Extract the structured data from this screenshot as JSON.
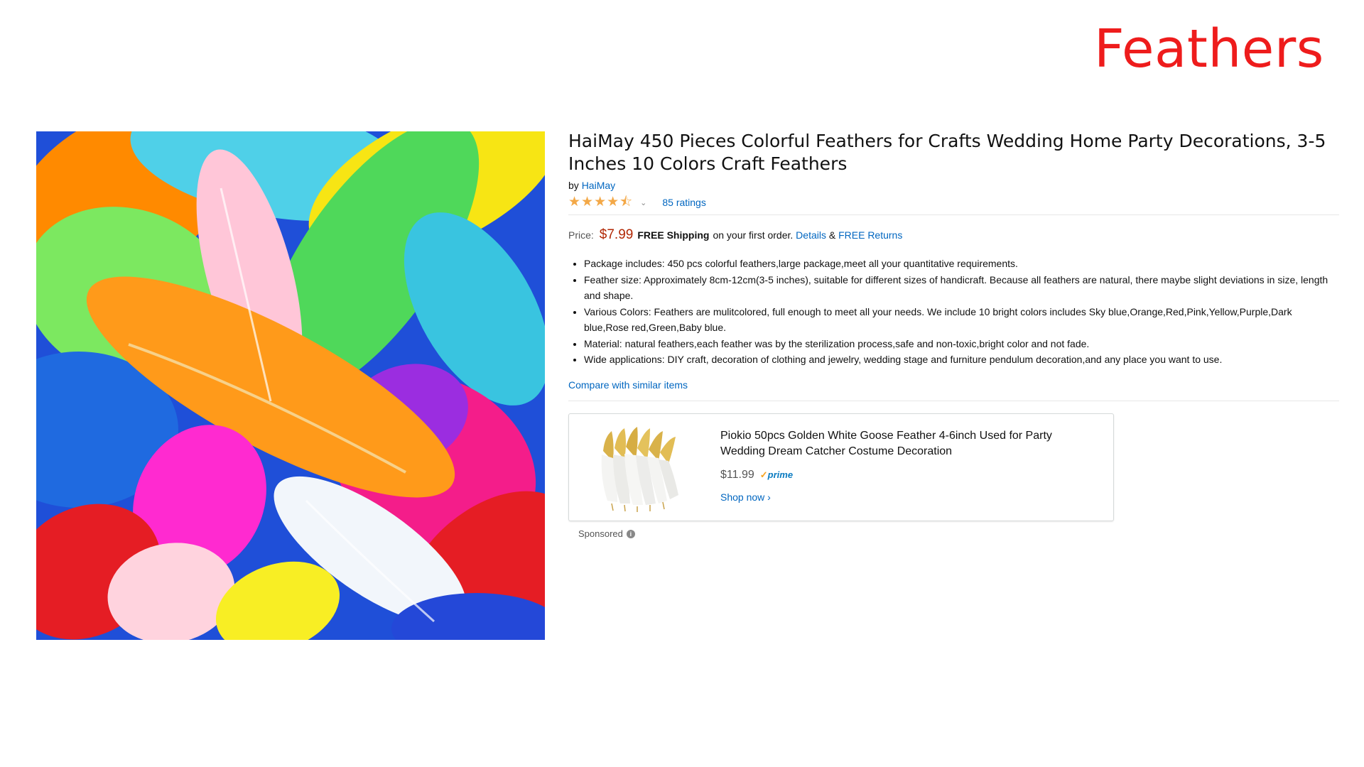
{
  "slide": {
    "title": "Feathers"
  },
  "product": {
    "title": "HaiMay 450 Pieces Colorful Feathers for Crafts Wedding Home Party Decorations, 3-5 Inches 10 Colors Craft Feathers",
    "by_prefix": "by",
    "brand": "HaiMay",
    "star_rating": 4.5,
    "stars_glyph": "★★★★⯪",
    "chevron": "⌄",
    "ratings": "85 ratings",
    "price_label": "Price:",
    "price": "$7.99",
    "free_shipping": "FREE Shipping",
    "first_order": "on your first order.",
    "details_link": "Details",
    "ampersand": "&",
    "free_returns": "FREE Returns",
    "bullets": [
      "Package includes: 450 pcs colorful feathers,large package,meet all your quantitative requirements.",
      "Feather size: Approximately 8cm-12cm(3-5 inches), suitable for different sizes of handicraft. Because all feathers are natural, there maybe slight deviations in size, length and shape.",
      "Various Colors: Feathers are mulitcolored, full enough to meet all your needs. We include 10 bright colors includes Sky blue,Orange,Red,Pink,Yellow,Purple,Dark blue,Rose red,Green,Baby blue.",
      "Material: natural feathers,each feather was by the sterilization process,safe and non-toxic,bright color and not fade.",
      "Wide applications: DIY craft, decoration of clothing and jewelry, wedding stage and furniture pendulum decoration,and any place you want to use."
    ],
    "compare_link": "Compare with similar items",
    "image_icon": "colorful-feathers-image"
  },
  "ad": {
    "title": "Piokio 50pcs Golden White Goose Feather 4-6inch Used for Party Wedding Dream Catcher Costume Decoration",
    "price": "$11.99",
    "prime_check": "✓",
    "prime": "prime",
    "shop_now": "Shop now ›",
    "sponsored": "Sponsored",
    "info_glyph": "i",
    "image_icon": "golden-white-feathers-image"
  },
  "colors": {
    "slide_title": "#ee1c1c",
    "link": "#0066c0",
    "price": "#b12704",
    "stars": "#f3a847"
  }
}
